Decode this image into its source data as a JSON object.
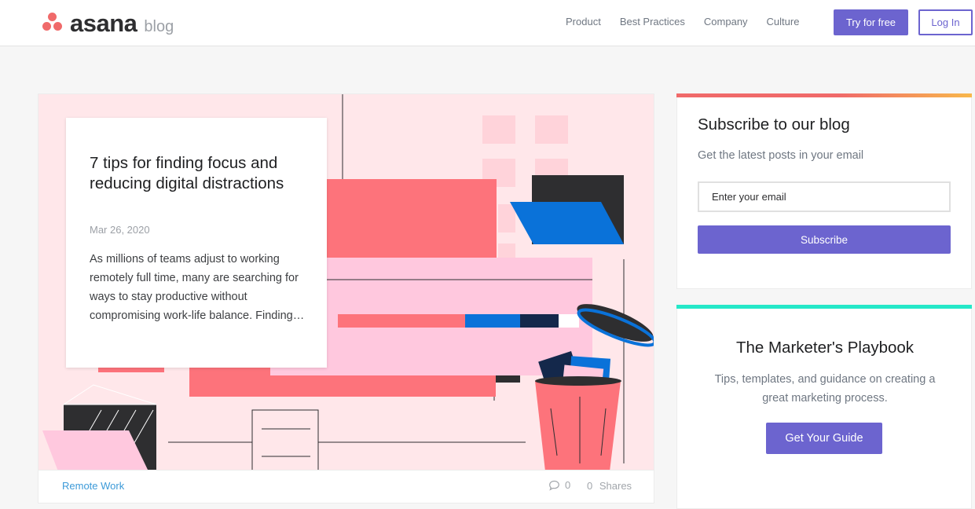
{
  "colors": {
    "brand_purple": "#6c64cf",
    "logo_coral": "#f06a6a",
    "subscribe_accent": "#f06a6a",
    "subscribe_accent_end": "#f8b84b",
    "playbook_accent": "#25e8c8",
    "tag_link": "#3c9ad8",
    "illustration_pink_bg": "#ffe7ea"
  },
  "header": {
    "logo_word": "asana",
    "logo_suffix": "blog",
    "nav": [
      "Product",
      "Best Practices",
      "Company",
      "Culture"
    ],
    "try_button": "Try for free",
    "login_button": "Log In"
  },
  "article": {
    "title": "7 tips for finding focus and reducing digital distractions",
    "date": "Mar 26, 2020",
    "excerpt": "As millions of teams adjust to working remotely full time, many are searching for ways to stay productive without compromising work-life balance. Finding…",
    "tag": "Remote Work",
    "comments_icon": "speech-bubble-icon",
    "comments_count": "0",
    "shares_count": "0",
    "shares_label": "Shares"
  },
  "subscribe": {
    "title": "Subscribe to our blog",
    "description": "Get the latest posts in your email",
    "email_placeholder": "Enter your email",
    "button": "Subscribe"
  },
  "playbook": {
    "title": "The Marketer's Playbook",
    "description": "Tips, templates, and guidance on creating a great marketing process.",
    "button": "Get Your Guide"
  }
}
